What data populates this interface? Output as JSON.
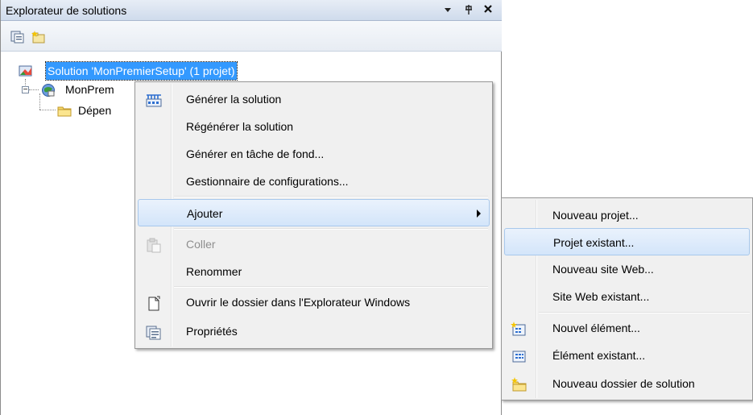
{
  "panel": {
    "title": "Explorateur de solutions",
    "dropdown_glyph": "▾",
    "pin_glyph": "ₚ",
    "close_glyph": "✕"
  },
  "toolbar": {
    "icons": [
      "properties-icon",
      "show-all-files-icon"
    ]
  },
  "tree": {
    "solution_label": "Solution 'MonPremierSetup' (1 projet)",
    "project_label": "MonPrem",
    "dependencies_label": "Dépen"
  },
  "context_menu": {
    "items": [
      {
        "label": "Générer la solution",
        "icon": "build-icon",
        "enabled": true
      },
      {
        "label": "Régénérer la solution",
        "icon": "",
        "enabled": true
      },
      {
        "label": "Générer en tâche de fond...",
        "icon": "",
        "enabled": true
      },
      {
        "label": "Gestionnaire de configurations...",
        "icon": "",
        "enabled": true
      },
      {
        "label": "Ajouter",
        "icon": "",
        "enabled": true,
        "submenu": true,
        "highlighted": true
      },
      {
        "label": "Coller",
        "icon": "paste-icon",
        "enabled": false
      },
      {
        "label": "Renommer",
        "icon": "",
        "enabled": true
      },
      {
        "label": "Ouvrir le dossier dans l'Explorateur Windows",
        "icon": "open-folder-icon",
        "enabled": true
      },
      {
        "label": "Propriétés",
        "icon": "properties-icon",
        "enabled": true
      }
    ]
  },
  "submenu": {
    "items": [
      {
        "label": "Nouveau projet...",
        "icon": ""
      },
      {
        "label": "Projet existant...",
        "icon": "",
        "highlighted": true
      },
      {
        "label": "Nouveau site Web...",
        "icon": ""
      },
      {
        "label": "Site Web existant...",
        "icon": ""
      },
      {
        "label": "Nouvel élément...",
        "icon": "new-item-icon"
      },
      {
        "label": "Élément existant...",
        "icon": "existing-item-icon"
      },
      {
        "label": "Nouveau dossier de solution",
        "icon": "new-solution-folder-icon"
      }
    ]
  },
  "colors": {
    "selection": "#3399ff",
    "menu_bg": "#f0f0f0",
    "highlight_border": "#a8c8ec"
  }
}
